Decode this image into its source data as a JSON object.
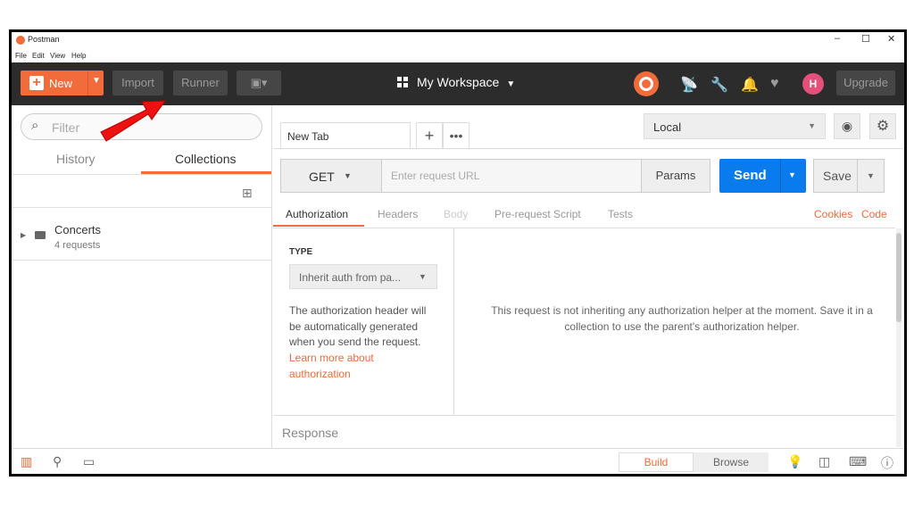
{
  "window": {
    "title": "Postman",
    "controls": [
      "–",
      "☐",
      "✕"
    ]
  },
  "menu": [
    "File",
    "Edit",
    "View",
    "Help"
  ],
  "header": {
    "new_label": "New",
    "import_label": "Import",
    "runner_label": "Runner",
    "workspace": "My Workspace",
    "upgrade_label": "Upgrade",
    "avatar_initials": "H"
  },
  "sidebar": {
    "filter_placeholder": "Filter",
    "tabs": [
      "History",
      "Collections"
    ],
    "active_tab": "Collections",
    "collections": [
      {
        "name": "Concerts",
        "sub": "4 requests"
      }
    ]
  },
  "main": {
    "tab_label": "New Tab",
    "environment": "Local",
    "method": "GET",
    "url_placeholder": "Enter request URL",
    "params_label": "Params",
    "send_label": "Send",
    "save_label": "Save",
    "request_tabs": [
      "Authorization",
      "Headers",
      "Body",
      "Pre-request Script",
      "Tests"
    ],
    "active_request_tab": "Authorization",
    "links": [
      "Cookies",
      "Code"
    ],
    "auth": {
      "type_label": "TYPE",
      "type_value": "Inherit auth from pa...",
      "description": "The authorization header will be automatically generated when you send the request.",
      "learn_more": "Learn more about authorization",
      "message": "This request is not inheriting any authorization helper at the moment. Save it in a collection to use the parent's authorization helper."
    },
    "response_label": "Response"
  },
  "footer": {
    "build_label": "Build",
    "browse_label": "Browse"
  },
  "colors": {
    "accent": "#f26b3a",
    "send": "#097bed",
    "header_bg": "#2c2c2c",
    "annotation_arrow": "#ee1111"
  }
}
